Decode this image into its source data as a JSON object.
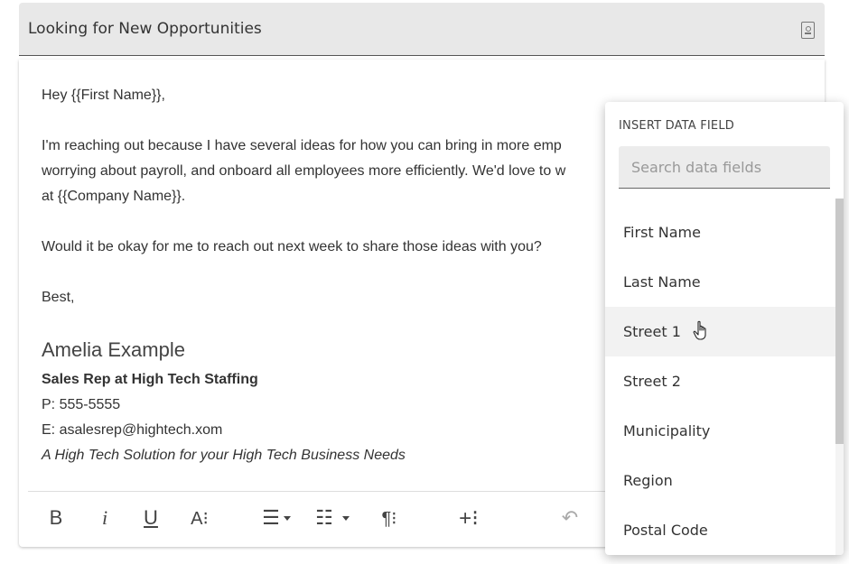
{
  "subject": {
    "text": "Looking for New Opportunities",
    "icon": "contact-card-icon"
  },
  "body": {
    "greeting": "Hey {{First Name}},",
    "para1_line1": "I'm reaching out because I have several ideas for how you can bring in more emp",
    "para1_line2": "worrying about payroll, and onboard all employees more efficiently. We'd love to w",
    "para1_line3": "at {{Company Name}}.",
    "para2": "Would it be okay for me to reach out next week to share those ideas with you?",
    "closing": "Best,"
  },
  "signature": {
    "name": "Amelia Example",
    "title": "Sales Rep at High Tech Staffing",
    "phone": "P: 555-5555",
    "email": "E: asalesrep@hightech.xom",
    "tagline": "A High Tech Solution for your High Tech Business Needs"
  },
  "toolbar": {
    "bold": "B",
    "italic": "i",
    "underline": "U",
    "font_size": "A⁝",
    "align": "☰",
    "list": "☷",
    "paragraph": "¶⁝",
    "insert": "+⁝",
    "undo": "↶"
  },
  "dropdown": {
    "title": "INSERT DATA FIELD",
    "search_placeholder": "Search data fields",
    "search_value": "",
    "items": [
      "First Name",
      "Last Name",
      "Street 1",
      "Street 2",
      "Municipality",
      "Region",
      "Postal Code"
    ],
    "hovered_item": "Street 1"
  },
  "colors": {
    "subject_bg": "#e8e8e8",
    "hover_bg": "#f2f2f2",
    "text": "#333333"
  }
}
